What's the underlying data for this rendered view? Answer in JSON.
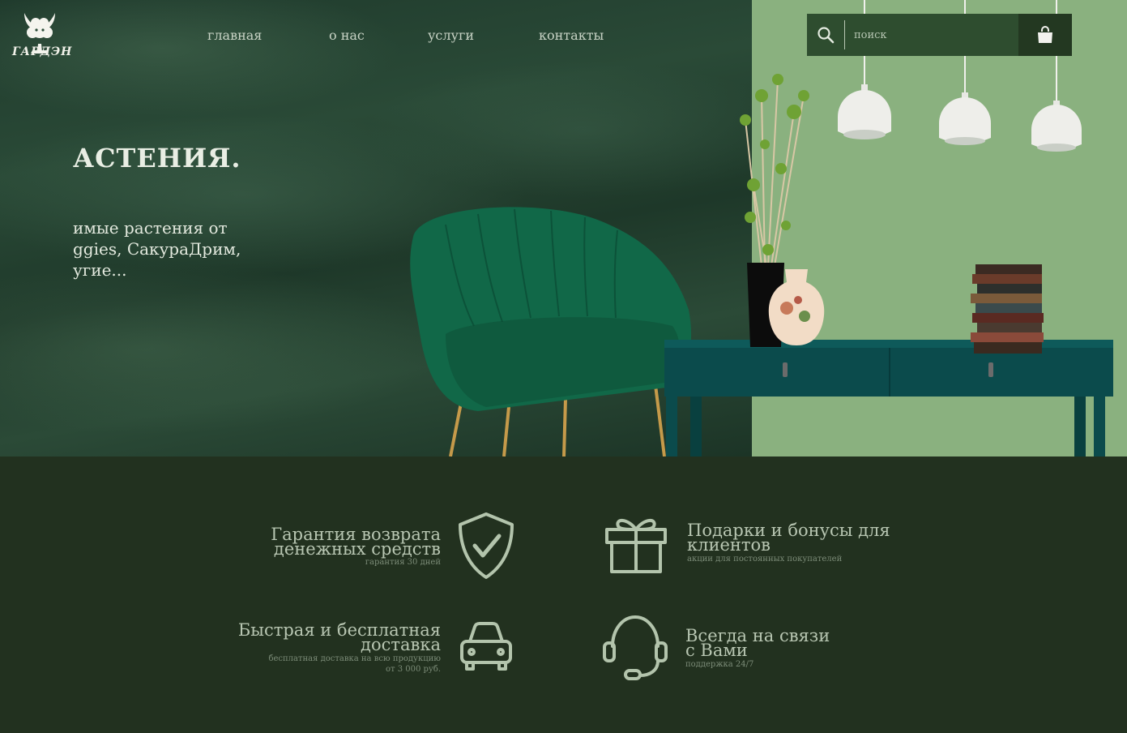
{
  "brand": {
    "name": "ГАРДЭН",
    "logo_icon": "tree-logo-icon"
  },
  "nav": {
    "items": [
      {
        "label": "главная"
      },
      {
        "label": "о нас"
      },
      {
        "label": "услуги"
      },
      {
        "label": "контакты"
      }
    ]
  },
  "search": {
    "placeholder": "поиск",
    "icon": "search-icon",
    "cart_icon": "shopping-bag-icon"
  },
  "hero": {
    "title": "АСТЕНИЯ.",
    "description_lines": [
      "имые растения от",
      "ggies, СакураДрим,",
      "угие..."
    ]
  },
  "features": [
    {
      "title_lines": [
        "Гарантия возврата",
        "денежных средств"
      ],
      "subtitle_lines": [
        "гарантия 30 дней"
      ],
      "icon": "shield-check-icon"
    },
    {
      "title_lines": [
        "Подарки и бонусы для",
        "клиентов"
      ],
      "subtitle_lines": [
        "акции для постоянных покупателей"
      ],
      "icon": "gift-icon"
    },
    {
      "title_lines": [
        "Быстрая и бесплатная",
        "доставка"
      ],
      "subtitle_lines": [
        "бесплатная доставка на всю продукцию",
        "от 3 000 руб."
      ],
      "icon": "car-icon"
    },
    {
      "title_lines": [
        "Всегда на связи",
        "с Вами"
      ],
      "subtitle_lines": [
        "поддержка 24/7"
      ],
      "icon": "headset-icon"
    }
  ],
  "colors": {
    "hero_dark_green": "#2a4a37",
    "hero_right_green": "#8ab17f",
    "footer_bg": "#22311f",
    "accent_text": "#b8c6b2"
  }
}
